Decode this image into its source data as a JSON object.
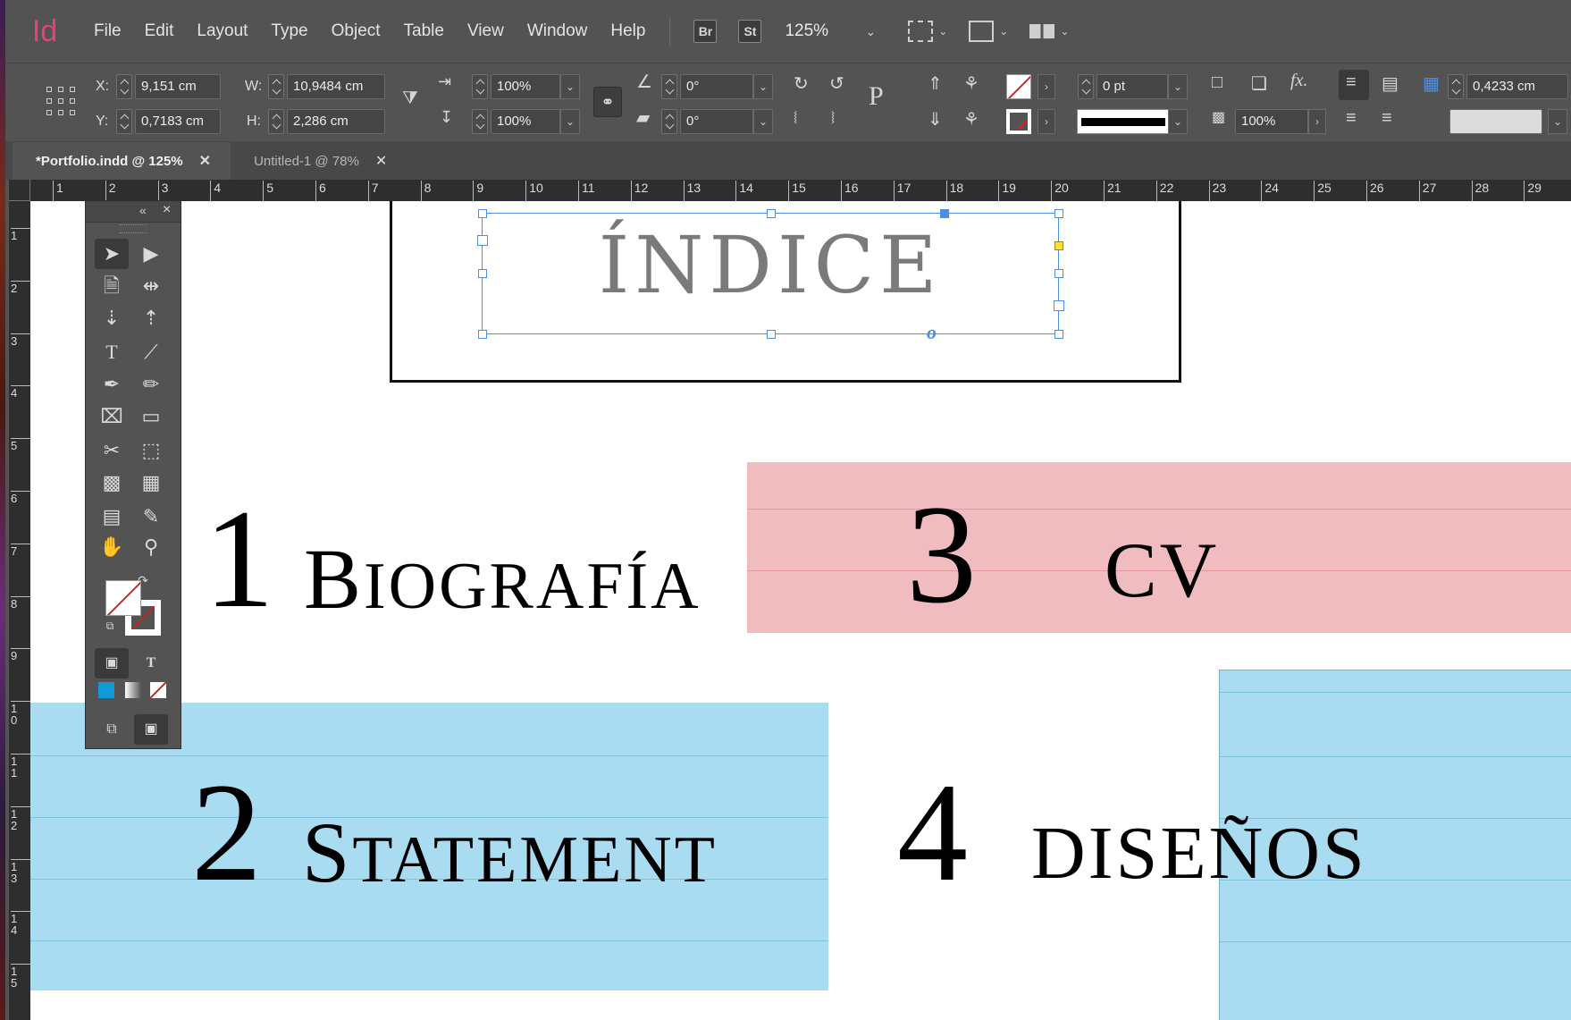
{
  "app": {
    "logo": "Id",
    "brand_color": "#e0447a"
  },
  "menu": [
    "File",
    "Edit",
    "Layout",
    "Type",
    "Object",
    "Table",
    "View",
    "Window",
    "Help"
  ],
  "menubar": {
    "bridge_label": "Br",
    "stock_label": "St",
    "zoom": "125%"
  },
  "control": {
    "x_label": "X:",
    "x_value": "9,151 cm",
    "y_label": "Y:",
    "y_value": "0,7183 cm",
    "w_label": "W:",
    "w_value": "10,9484 cm",
    "h_label": "H:",
    "h_value": "2,286 cm",
    "scale_x": "100%",
    "scale_y": "100%",
    "rotate": "0°",
    "shear": "0°",
    "stroke_weight": "0 pt",
    "opacity": "100%",
    "gutter": "0,4233 cm",
    "text_frame_label": "P",
    "fx_label": "fx."
  },
  "tabs": [
    {
      "label": "*Portfolio.indd @ 125%",
      "active": true
    },
    {
      "label": "Untitled-1 @ 78%",
      "active": false
    }
  ],
  "ruler_h": [
    "1",
    "2",
    "3",
    "4",
    "5",
    "6",
    "7",
    "8",
    "9",
    "10",
    "11",
    "12",
    "13",
    "14",
    "15",
    "16",
    "17",
    "18",
    "19",
    "20",
    "21",
    "22",
    "23",
    "24",
    "25",
    "26",
    "27",
    "28",
    "29"
  ],
  "ruler_v": [
    "1",
    "2",
    "3",
    "4",
    "5",
    "6",
    "7",
    "8",
    "9",
    "1\n0",
    "1\n1",
    "1\n2",
    "1\n3",
    "1\n4",
    "1\n5"
  ],
  "page": {
    "index_title": "ÍNDICE",
    "overset_mark": "o",
    "sections": [
      {
        "num": "1",
        "cap": "B",
        "rest": "IOGRAFÍA"
      },
      {
        "num": "2",
        "cap": "S",
        "rest": "TATEMENT"
      },
      {
        "num": "3",
        "cap": "",
        "rest": "CV"
      },
      {
        "num": "4",
        "cap": "",
        "rest": "diseños"
      }
    ],
    "colors": {
      "pink": "#f1bcc0",
      "blue": "#a9dcf1",
      "selection": "#4a90e2"
    }
  },
  "toolpanel": {
    "collapse_icon": "«",
    "close_icon": "×",
    "type_tool_label": "T",
    "text_formatting_label": "T"
  }
}
